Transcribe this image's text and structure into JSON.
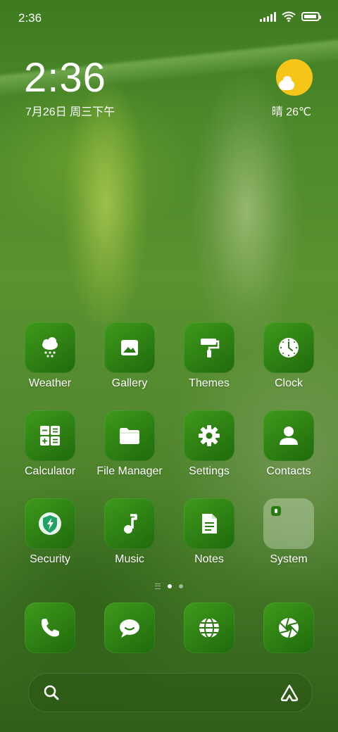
{
  "status_bar": {
    "time": "2:36",
    "battery_level": 0.95
  },
  "widget": {
    "time": "2:36",
    "date": "7月26日 周三下午",
    "weather": "晴 26℃"
  },
  "apps": [
    {
      "label": "Weather",
      "icon": "weather-cloud-snow-icon"
    },
    {
      "label": "Gallery",
      "icon": "image-icon"
    },
    {
      "label": "Themes",
      "icon": "paint-roller-icon"
    },
    {
      "label": "Clock",
      "icon": "clock-icon"
    },
    {
      "label": "Calculator",
      "icon": "calculator-icon"
    },
    {
      "label": "File Manager",
      "icon": "folder-icon"
    },
    {
      "label": "Settings",
      "icon": "gear-icon"
    },
    {
      "label": "Contacts",
      "icon": "person-icon"
    },
    {
      "label": "Security",
      "icon": "shield-bolt-icon"
    },
    {
      "label": "Music",
      "icon": "music-note-icon"
    },
    {
      "label": "Notes",
      "icon": "note-icon"
    },
    {
      "label": "System",
      "icon": "folder-icon"
    }
  ],
  "dock": [
    {
      "icon": "phone-icon"
    },
    {
      "icon": "message-icon"
    },
    {
      "icon": "browser-globe-icon"
    },
    {
      "icon": "camera-shutter-icon"
    }
  ],
  "page_indicator": {
    "total": 2,
    "active": 1
  },
  "search_bar": {
    "left_icon": "search-icon",
    "right_icon": "assistant-icon"
  }
}
